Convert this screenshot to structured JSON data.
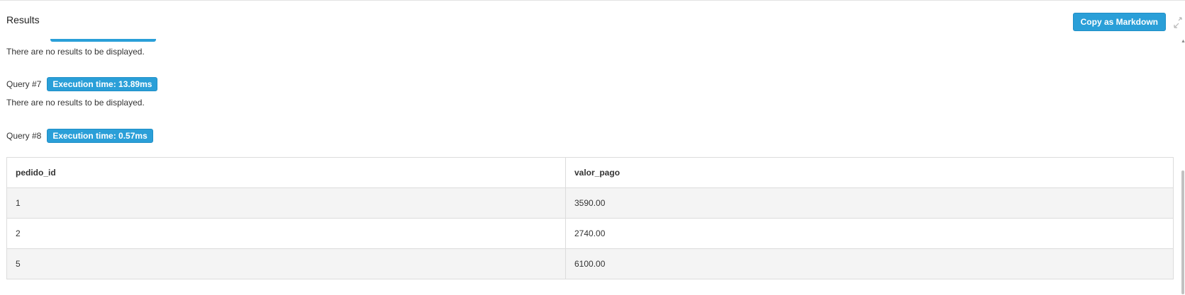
{
  "header": {
    "title": "Results",
    "copy_button_label": "Copy as Markdown",
    "expand_icon": "expand-icon"
  },
  "queries": [
    {
      "result_text": "There are no results to be displayed."
    },
    {
      "label": "Query #7",
      "execution_time": "Execution time: 13.89ms",
      "result_text": "There are no results to be displayed."
    },
    {
      "label": "Query #8",
      "execution_time": "Execution time: 0.57ms"
    }
  ],
  "table": {
    "columns": [
      "pedido_id",
      "valor_pago"
    ],
    "rows": [
      [
        "1",
        "3590.00"
      ],
      [
        "2",
        "2740.00"
      ],
      [
        "5",
        "6100.00"
      ]
    ]
  },
  "colors": {
    "accent": "#2a9fd8",
    "row_stripe": "#f4f4f4",
    "border": "#dcdcdc"
  }
}
